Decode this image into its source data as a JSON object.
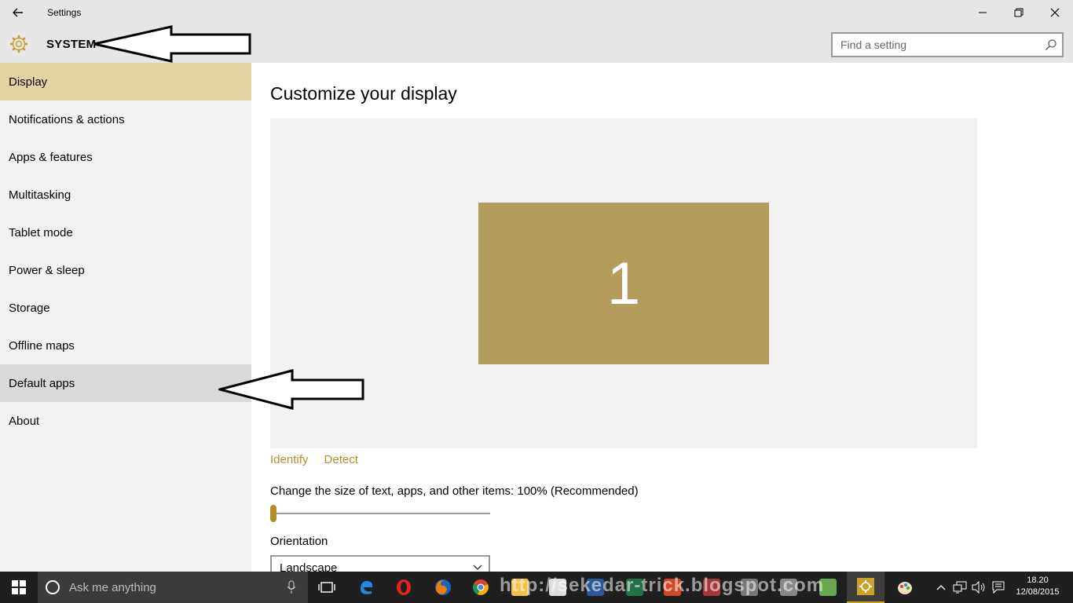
{
  "window": {
    "title": "Settings"
  },
  "header": {
    "section": "SYSTEM",
    "search_placeholder": "Find a setting"
  },
  "sidebar": {
    "items": [
      {
        "label": "Display"
      },
      {
        "label": "Notifications & actions"
      },
      {
        "label": "Apps & features"
      },
      {
        "label": "Multitasking"
      },
      {
        "label": "Tablet mode"
      },
      {
        "label": "Power & sleep"
      },
      {
        "label": "Storage"
      },
      {
        "label": "Offline maps"
      },
      {
        "label": "Default apps"
      },
      {
        "label": "About"
      }
    ]
  },
  "main": {
    "title": "Customize your display",
    "monitor_number": "1",
    "identify": "Identify",
    "detect": "Detect",
    "scale_label": "Change the size of text, apps, and other items: 100% (Recommended)",
    "scale_value_percent": 0,
    "orientation_label": "Orientation",
    "orientation_value": "Landscape"
  },
  "taskbar": {
    "search_placeholder": "Ask me anything",
    "watermark": "http://sekedar-trick.blogspot.com",
    "time": "18.20",
    "date": "12/08/2015"
  },
  "colors": {
    "accent": "#b38f2a",
    "monitor": "#b49d5a",
    "selected_nav": "#e2d3a3",
    "taskbar": "#1f1f1f"
  }
}
